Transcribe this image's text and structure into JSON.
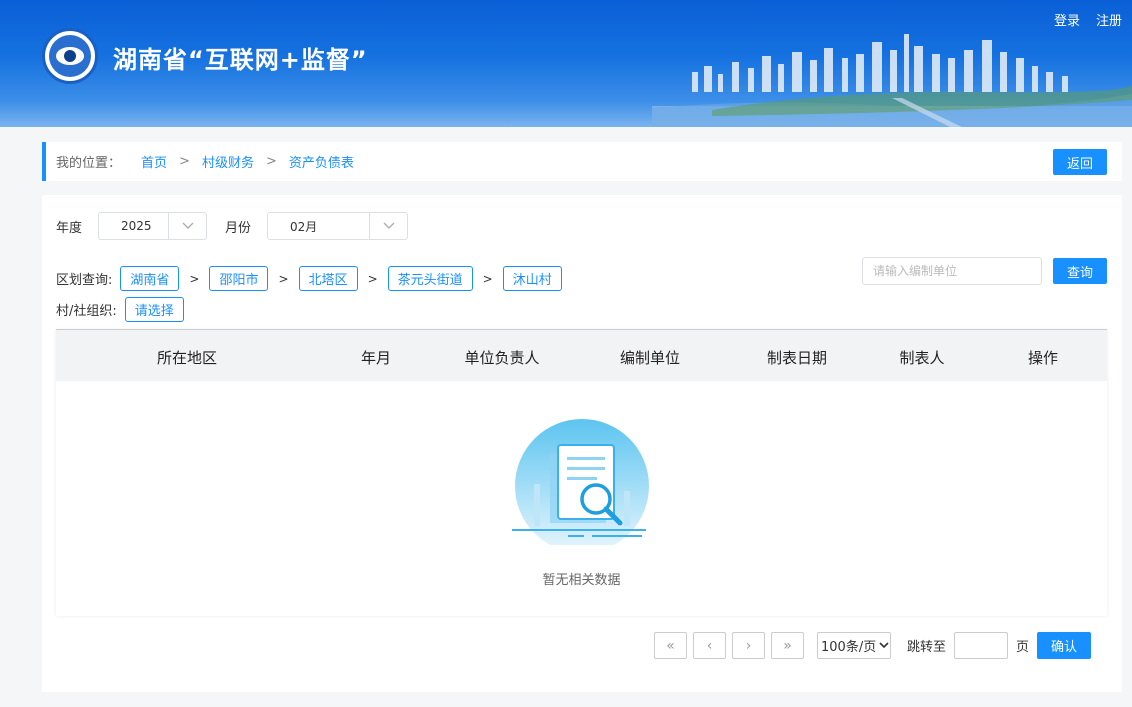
{
  "header": {
    "title": "湖南省“互联网+监督”",
    "login": "登录",
    "register": "注册"
  },
  "breadcrumb": {
    "label": "我的位置：",
    "items": [
      "首页",
      "村级财务",
      "资产负债表"
    ],
    "separator": ">",
    "back": "返回"
  },
  "filters": {
    "year_label": "年度",
    "year_value": "2025",
    "month_label": "月份",
    "month_value": "02月"
  },
  "region": {
    "label": "区划查询:",
    "items": [
      "湖南省",
      "邵阳市",
      "北塔区",
      "茶元头街道",
      "沐山村"
    ],
    "separator": ">"
  },
  "org": {
    "label": "村/社组织:",
    "select": "请选择"
  },
  "search": {
    "placeholder": "请输入编制单位",
    "button": "查询"
  },
  "table": {
    "columns": [
      "所在地区",
      "年月",
      "单位负责人",
      "编制单位",
      "制表日期",
      "制表人",
      "操作"
    ],
    "empty_text": "暂无相关数据"
  },
  "pagination": {
    "first": "«",
    "prev": "‹",
    "next": "›",
    "last": "»",
    "page_size": "100条/页",
    "jump_label": "跳转至",
    "page_unit": "页",
    "confirm": "确认"
  },
  "colors": {
    "accent": "#1890ff",
    "header_blue": "#0a5fd6"
  }
}
